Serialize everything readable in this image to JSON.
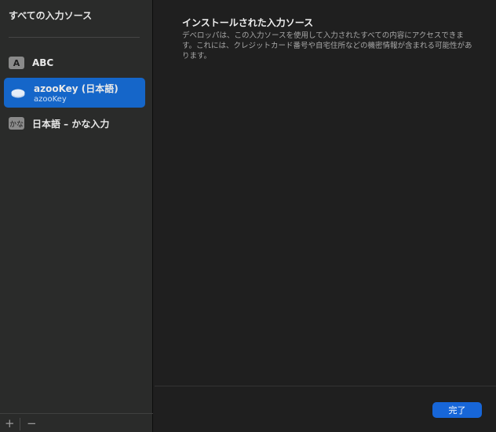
{
  "sidebar": {
    "title": "すべての入力ソース",
    "items": [
      {
        "icon_text": "A",
        "label": "ABC"
      },
      {
        "label": "azooKey (日本語)",
        "sublabel": "azooKey"
      },
      {
        "icon_text": "かな",
        "label": "日本語 – かな入力"
      }
    ],
    "add_label": "+",
    "remove_label": "−"
  },
  "main": {
    "title": "インストールされた入力ソース",
    "description": "デベロッパは、この入力ソースを使用して入力されたすべての内容にアクセスできます。これには、クレジットカード番号や自宅住所などの機密情報が含まれる可能性があります。",
    "done_label": "完了"
  }
}
